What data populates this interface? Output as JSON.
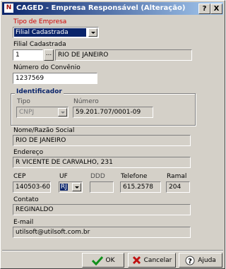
{
  "window": {
    "title": "CAGED - Empresa Responsável (Alteração)",
    "icon": "caged-app-icon",
    "help_btn": "?",
    "close_btn": "X"
  },
  "form": {
    "tipo_empresa": {
      "label": "Tipo de Empresa",
      "value": "Filial Cadastrada"
    },
    "filial": {
      "label": "Filial Cadastrada",
      "code": "1",
      "lookup": "...",
      "name": "RIO DE JANEIRO"
    },
    "convenio": {
      "label": "Número do Convênio",
      "value": "1237569"
    },
    "identificador": {
      "title": "Identificador",
      "tipo_label": "Tipo",
      "tipo_value": "CNPJ",
      "numero_label": "Número",
      "numero_value": "59.201.707/0001-09"
    },
    "razao_social": {
      "label": "Nome/Razão Social",
      "value": "RIO DE JANEIRO"
    },
    "endereco": {
      "label": "Endereço",
      "value": "R VICENTE DE CARVALHO, 231"
    },
    "cep": {
      "label": "CEP",
      "value": "140503-60"
    },
    "uf": {
      "label": "UF",
      "value": "RJ"
    },
    "ddd": {
      "label": "DDD",
      "value": ""
    },
    "telefone": {
      "label": "Telefone",
      "value": "615.2578"
    },
    "ramal": {
      "label": "Ramal",
      "value": "204"
    },
    "contato": {
      "label": "Contato",
      "value": "REGINALDO"
    },
    "email": {
      "label": "E-mail",
      "value": "utilsoft@utilsoft.com.br"
    }
  },
  "buttons": {
    "ok": {
      "label": "OK",
      "icon": "check-icon"
    },
    "cancel": {
      "label": "Cancelar",
      "icon": "x-icon"
    },
    "help": {
      "label": "Ajuda",
      "icon": "question-icon"
    }
  },
  "colors": {
    "titlebar_start": "#0a246a",
    "titlebar_end": "#a6caf0",
    "face": "#d4d0c8",
    "red_label": "#d00000",
    "group_title": "#0a246a"
  }
}
